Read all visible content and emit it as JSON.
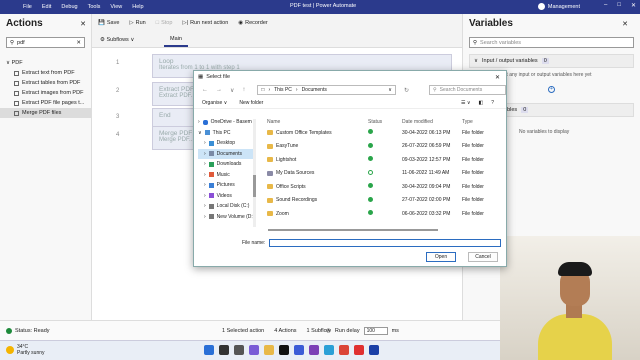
{
  "window": {
    "menu": [
      "File",
      "Edit",
      "Debug",
      "Tools",
      "View",
      "Help"
    ],
    "title": "PDF test | Power Automate",
    "user": "Management"
  },
  "actions_pane": {
    "title": "Actions",
    "search_value": "pdf",
    "group": "PDF",
    "items": [
      "Extract text from PDF",
      "Extract tables from PDF",
      "Extract images from PDF",
      "Extract PDF file pages t...",
      "Merge PDF files"
    ]
  },
  "toolbar": {
    "save": "Save",
    "run": "Run",
    "stop": "Stop",
    "run_next": "Run next action",
    "recorder": "Recorder"
  },
  "tabs": {
    "subflows": "Subflows",
    "main": "Main"
  },
  "flow": [
    {
      "num": "1",
      "title": "Loop",
      "sub": "Iterates from 1 to 1 with step 1"
    },
    {
      "num": "2",
      "title": "Extract PDF",
      "sub": "Extract PDF..."
    },
    {
      "num": "3",
      "title": "End",
      "sub": ""
    },
    {
      "num": "4",
      "title": "Merge PDF",
      "sub": "Merge PDF..."
    }
  ],
  "variables_pane": {
    "title": "Variables",
    "search_placeholder": "Search variables",
    "io_label": "Input / output variables",
    "io_count": "0",
    "io_empty": "There aren't any input or output variables here yet",
    "flow_label": "Flow variables",
    "flow_count": "0",
    "flow_empty": "No variables to display"
  },
  "status_bar": {
    "status": "Status: Ready",
    "selected": "1 Selected action",
    "actions": "4 Actions",
    "subflow": "1 Subflow",
    "run_delay_label": "Run delay",
    "run_delay_value": "100",
    "unit": "ms"
  },
  "taskbar": {
    "temp": "34°C",
    "weather": "Partly sunny"
  },
  "dialog": {
    "title": "Select file",
    "path": [
      "This PC",
      "Documents"
    ],
    "search_placeholder": "Search Documents",
    "organise": "Organise",
    "new_folder": "New folder",
    "nav_items": [
      "OneDrive - Basem",
      "This PC",
      "Desktop",
      "Documents",
      "Downloads",
      "Music",
      "Pictures",
      "Videos",
      "Local Disk (C:)",
      "New Volume (D:)"
    ],
    "columns": [
      "Name",
      "Status",
      "Date modified",
      "Type"
    ],
    "files": [
      {
        "name": "Custom Office Templates",
        "date": "30-04-2022 06:13 PM",
        "type": "File folder"
      },
      {
        "name": "EasyTune",
        "date": "26-07-2022 06:59 PM",
        "type": "File folder"
      },
      {
        "name": "Lightshot",
        "date": "09-03-2022 12:57 PM",
        "type": "File folder"
      },
      {
        "name": "My Data Sources",
        "date": "11-06-2022 11:49 AM",
        "type": "File folder"
      },
      {
        "name": "Office Scripts",
        "date": "30-04-2022 09:04 PM",
        "type": "File folder"
      },
      {
        "name": "Sound Recordings",
        "date": "27-07-2022 02:00 PM",
        "type": "File folder"
      },
      {
        "name": "Zoom",
        "date": "06-06-2022 03:32 PM",
        "type": "File folder"
      }
    ],
    "file_name_label": "File name:",
    "open": "Open",
    "cancel": "Cancel"
  }
}
